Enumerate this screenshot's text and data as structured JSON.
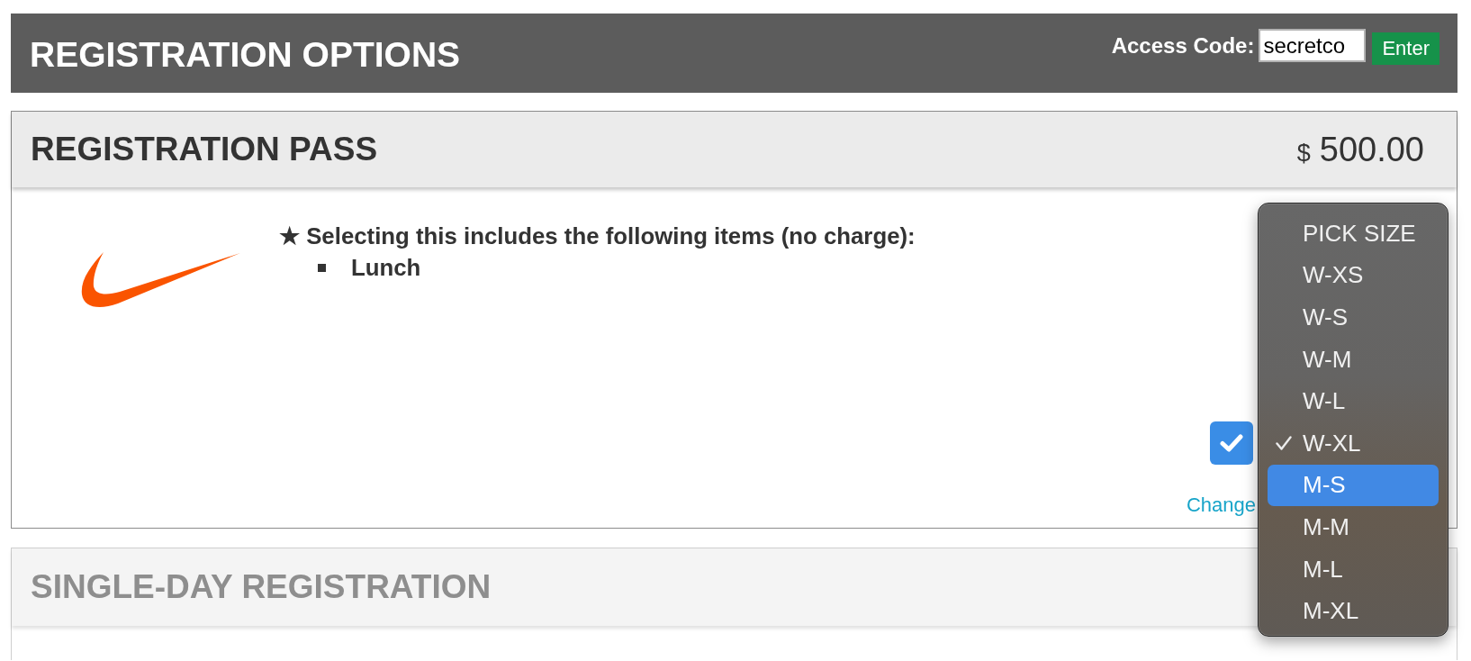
{
  "header": {
    "title": "REGISTRATION OPTIONS",
    "access_code": {
      "label": "Access Code:",
      "value": "secretco"
    },
    "enter_button": "Enter"
  },
  "options": [
    {
      "title": "REGISTRATION PASS",
      "disabled": false,
      "currency": "$",
      "price": "500.00",
      "note": "★ Selecting this includes the following items (no charge):",
      "included_items": [
        "Lunch"
      ],
      "checked": true,
      "change_link": "Change"
    },
    {
      "title": "SINGLE-DAY REGISTRATION",
      "disabled": true
    }
  ],
  "size_menu": {
    "options": [
      {
        "label": "PICK SIZE",
        "selected": false,
        "highlighted": false
      },
      {
        "label": "W-XS",
        "selected": false,
        "highlighted": false
      },
      {
        "label": "W-S",
        "selected": false,
        "highlighted": false
      },
      {
        "label": "W-M",
        "selected": false,
        "highlighted": false
      },
      {
        "label": "W-L",
        "selected": false,
        "highlighted": false
      },
      {
        "label": "W-XL",
        "selected": true,
        "highlighted": false
      },
      {
        "label": "M-S",
        "selected": false,
        "highlighted": true
      },
      {
        "label": "M-M",
        "selected": false,
        "highlighted": false
      },
      {
        "label": "M-L",
        "selected": false,
        "highlighted": false
      },
      {
        "label": "M-XL",
        "selected": false,
        "highlighted": false
      }
    ]
  }
}
